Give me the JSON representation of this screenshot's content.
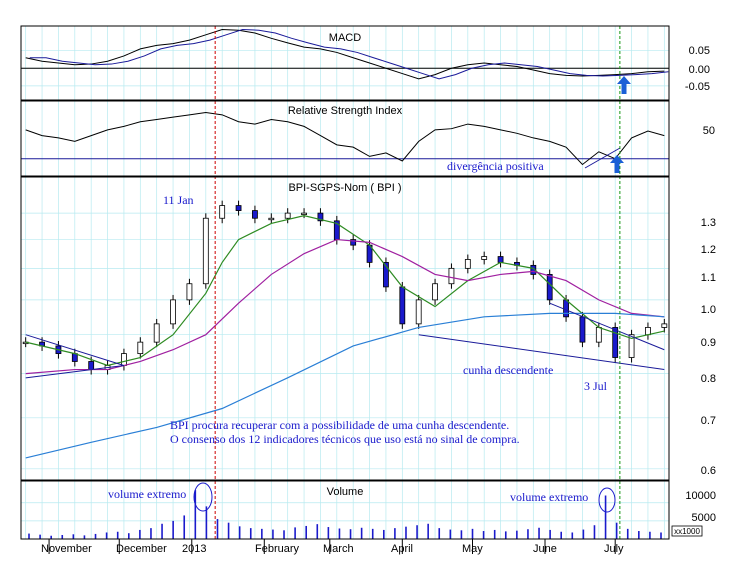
{
  "colors": {
    "grid": "#b7eaf0",
    "frame": "#000000",
    "annotation": "#1a1acc",
    "up_arrow": "#1a5fd6",
    "price_up": "#ffffff",
    "price_down": "#1a1acc",
    "ma_short": "#2e8b22",
    "ma_mid": "#a020a0",
    "ma_long": "#2a7fd6",
    "event_red": "#cc0000",
    "event_green": "#119911",
    "trend_line": "#1a1a99"
  },
  "chart_data": [
    {
      "type": "line",
      "title": "MACD",
      "y_ticks": [
        "0.05",
        "0.00",
        "-0.05"
      ],
      "ylim": [
        -0.09,
        0.12
      ],
      "series": [
        {
          "style": "macd",
          "points": [
            [
              "2012-10-22",
              0.03
            ],
            [
              "2012-10-29",
              0.02
            ],
            [
              "2012-11-05",
              0.015
            ],
            [
              "2012-11-12",
              0.01
            ],
            [
              "2012-11-19",
              0.012
            ],
            [
              "2012-11-26",
              0.02
            ],
            [
              "2012-12-03",
              0.035
            ],
            [
              "2012-12-10",
              0.055
            ],
            [
              "2012-12-17",
              0.065
            ],
            [
              "2012-12-24",
              0.07
            ],
            [
              "2012-12-31",
              0.08
            ],
            [
              "2013-01-07",
              0.095
            ],
            [
              "2013-01-14",
              0.11
            ],
            [
              "2013-01-21",
              0.108
            ],
            [
              "2013-01-28",
              0.1
            ],
            [
              "2013-02-04",
              0.085
            ],
            [
              "2013-02-11",
              0.072
            ],
            [
              "2013-02-18",
              0.06
            ],
            [
              "2013-02-25",
              0.055
            ],
            [
              "2013-03-04",
              0.045
            ],
            [
              "2013-03-11",
              0.03
            ],
            [
              "2013-03-18",
              0.015
            ],
            [
              "2013-03-25",
              0.0
            ],
            [
              "2013-04-01",
              -0.015
            ],
            [
              "2013-04-08",
              -0.03
            ],
            [
              "2013-04-15",
              -0.018
            ],
            [
              "2013-04-22",
              0.0
            ],
            [
              "2013-04-29",
              0.01
            ],
            [
              "2013-05-06",
              0.015
            ],
            [
              "2013-05-13",
              0.01
            ],
            [
              "2013-05-20",
              0.005
            ],
            [
              "2013-05-27",
              -0.005
            ],
            [
              "2013-06-03",
              -0.015
            ],
            [
              "2013-06-10",
              -0.02
            ],
            [
              "2013-06-17",
              -0.022
            ],
            [
              "2013-06-24",
              -0.02
            ],
            [
              "2013-07-01",
              -0.018
            ],
            [
              "2013-07-08",
              -0.015
            ],
            [
              "2013-07-15",
              -0.01
            ],
            [
              "2013-07-22",
              -0.008
            ]
          ]
        }
      ]
    },
    {
      "type": "line",
      "title": "Relative Strength Index",
      "y_ticks": [
        "50"
      ],
      "ylim": [
        15,
        80
      ],
      "series": [
        {
          "style": "rsi",
          "points": [
            [
              "2012-10-22",
              55
            ],
            [
              "2012-10-29",
              50
            ],
            [
              "2012-11-05",
              48
            ],
            [
              "2012-11-12",
              45
            ],
            [
              "2012-11-19",
              50
            ],
            [
              "2012-11-26",
              55
            ],
            [
              "2012-12-03",
              58
            ],
            [
              "2012-12-10",
              62
            ],
            [
              "2012-12-17",
              64
            ],
            [
              "2012-12-24",
              66
            ],
            [
              "2012-12-31",
              68
            ],
            [
              "2013-01-07",
              70
            ],
            [
              "2013-01-14",
              68
            ],
            [
              "2013-01-21",
              62
            ],
            [
              "2013-01-28",
              60
            ],
            [
              "2013-02-04",
              64
            ],
            [
              "2013-02-11",
              62
            ],
            [
              "2013-02-18",
              58
            ],
            [
              "2013-02-25",
              50
            ],
            [
              "2013-03-04",
              42
            ],
            [
              "2013-03-11",
              40
            ],
            [
              "2013-03-18",
              32
            ],
            [
              "2013-03-25",
              35
            ],
            [
              "2013-04-01",
              28
            ],
            [
              "2013-04-08",
              45
            ],
            [
              "2013-04-15",
              55
            ],
            [
              "2013-04-22",
              56
            ],
            [
              "2013-04-29",
              60
            ],
            [
              "2013-05-06",
              58
            ],
            [
              "2013-05-13",
              55
            ],
            [
              "2013-05-20",
              52
            ],
            [
              "2013-05-27",
              48
            ],
            [
              "2013-06-03",
              45
            ],
            [
              "2013-06-10",
              40
            ],
            [
              "2013-06-17",
              25
            ],
            [
              "2013-06-24",
              36
            ],
            [
              "2013-07-01",
              30
            ],
            [
              "2013-07-08",
              48
            ],
            [
              "2013-07-15",
              54
            ],
            [
              "2013-07-22",
              50
            ]
          ]
        }
      ],
      "reference_level": 30
    },
    {
      "type": "line",
      "title": "BPI-SGPS-Nom ( BPI )",
      "y_ticks": [
        "1.3",
        "1.2",
        "1.1",
        "1.0",
        "0.9",
        "0.8",
        "0.7",
        "0.6"
      ],
      "y_scale": "log",
      "ylim": [
        0.58,
        1.45
      ],
      "series": [
        {
          "style": "price",
          "points": [
            [
              "2012-10-22",
              0.88
            ],
            [
              "2012-10-29",
              0.87
            ],
            [
              "2012-11-05",
              0.85
            ],
            [
              "2012-11-12",
              0.83
            ],
            [
              "2012-11-19",
              0.81
            ],
            [
              "2012-11-26",
              0.82
            ],
            [
              "2012-12-03",
              0.85
            ],
            [
              "2012-12-10",
              0.88
            ],
            [
              "2012-12-17",
              0.93
            ],
            [
              "2012-12-24",
              1.0
            ],
            [
              "2012-12-31",
              1.05
            ],
            [
              "2013-01-07",
              1.28
            ],
            [
              "2013-01-14",
              1.33
            ],
            [
              "2013-01-21",
              1.31
            ],
            [
              "2013-01-28",
              1.28
            ],
            [
              "2013-02-04",
              1.28
            ],
            [
              "2013-02-11",
              1.3
            ],
            [
              "2013-02-18",
              1.3
            ],
            [
              "2013-02-25",
              1.27
            ],
            [
              "2013-03-04",
              1.2
            ],
            [
              "2013-03-11",
              1.18
            ],
            [
              "2013-03-18",
              1.12
            ],
            [
              "2013-03-25",
              1.04
            ],
            [
              "2013-04-01",
              0.93
            ],
            [
              "2013-04-08",
              1.0
            ],
            [
              "2013-04-15",
              1.05
            ],
            [
              "2013-04-22",
              1.1
            ],
            [
              "2013-04-29",
              1.13
            ],
            [
              "2013-05-06",
              1.14
            ],
            [
              "2013-05-13",
              1.12
            ],
            [
              "2013-05-20",
              1.11
            ],
            [
              "2013-05-27",
              1.08
            ],
            [
              "2013-06-03",
              1.0
            ],
            [
              "2013-06-10",
              0.95
            ],
            [
              "2013-06-17",
              0.88
            ],
            [
              "2013-06-24",
              0.92
            ],
            [
              "2013-07-01",
              0.84
            ],
            [
              "2013-07-08",
              0.9
            ],
            [
              "2013-07-15",
              0.92
            ],
            [
              "2013-07-22",
              0.93
            ]
          ]
        },
        {
          "style": "ma_short",
          "points": [
            [
              "2012-10-22",
              0.88
            ],
            [
              "2012-11-12",
              0.85
            ],
            [
              "2012-11-26",
              0.82
            ],
            [
              "2012-12-10",
              0.84
            ],
            [
              "2012-12-24",
              0.9
            ],
            [
              "2013-01-07",
              1.02
            ],
            [
              "2013-01-14",
              1.12
            ],
            [
              "2013-01-21",
              1.2
            ],
            [
              "2013-02-04",
              1.26
            ],
            [
              "2013-02-18",
              1.29
            ],
            [
              "2013-03-04",
              1.26
            ],
            [
              "2013-03-18",
              1.18
            ],
            [
              "2013-04-01",
              1.04
            ],
            [
              "2013-04-15",
              0.98
            ],
            [
              "2013-04-29",
              1.06
            ],
            [
              "2013-05-13",
              1.12
            ],
            [
              "2013-05-27",
              1.1
            ],
            [
              "2013-06-10",
              1.0
            ],
            [
              "2013-06-24",
              0.92
            ],
            [
              "2013-07-08",
              0.89
            ],
            [
              "2013-07-22",
              0.91
            ]
          ]
        },
        {
          "style": "ma_mid",
          "points": [
            [
              "2012-10-22",
              0.8
            ],
            [
              "2012-11-12",
              0.81
            ],
            [
              "2012-11-26",
              0.81
            ],
            [
              "2012-12-10",
              0.83
            ],
            [
              "2012-12-24",
              0.86
            ],
            [
              "2013-01-07",
              0.9
            ],
            [
              "2013-01-21",
              0.99
            ],
            [
              "2013-02-04",
              1.08
            ],
            [
              "2013-02-18",
              1.15
            ],
            [
              "2013-03-04",
              1.2
            ],
            [
              "2013-03-18",
              1.19
            ],
            [
              "2013-04-01",
              1.14
            ],
            [
              "2013-04-15",
              1.08
            ],
            [
              "2013-04-29",
              1.06
            ],
            [
              "2013-05-13",
              1.08
            ],
            [
              "2013-05-27",
              1.09
            ],
            [
              "2013-06-10",
              1.06
            ],
            [
              "2013-06-24",
              1.0
            ],
            [
              "2013-07-08",
              0.96
            ],
            [
              "2013-07-22",
              0.95
            ]
          ]
        },
        {
          "style": "ma_long",
          "points": [
            [
              "2012-10-22",
              0.62
            ],
            [
              "2012-11-19",
              0.65
            ],
            [
              "2012-12-17",
              0.68
            ],
            [
              "2013-01-14",
              0.72
            ],
            [
              "2013-02-11",
              0.79
            ],
            [
              "2013-03-11",
              0.87
            ],
            [
              "2013-04-08",
              0.92
            ],
            [
              "2013-05-06",
              0.95
            ],
            [
              "2013-06-03",
              0.96
            ],
            [
              "2013-07-01",
              0.96
            ],
            [
              "2013-07-22",
              0.95
            ]
          ]
        }
      ],
      "trend_lines": [
        {
          "style": "trend",
          "points": [
            [
              "2012-10-22",
              0.9
            ],
            [
              "2012-12-03",
              0.82
            ]
          ]
        },
        {
          "style": "trend",
          "points": [
            [
              "2012-10-22",
              0.79
            ],
            [
              "2012-12-03",
              0.82
            ]
          ]
        },
        {
          "style": "trend",
          "points": [
            [
              "2013-04-08",
              0.9
            ],
            [
              "2013-07-22",
              0.81
            ]
          ]
        },
        {
          "style": "trend",
          "points": [
            [
              "2013-06-03",
              0.99
            ],
            [
              "2013-07-22",
              0.86
            ]
          ]
        }
      ],
      "annotations": {
        "jan_label": "11  Jan",
        "wedge_label": "cunha descendente",
        "jul_label": "3 Jul",
        "comment_line1": "BPI procura recuperar com a possibilidade de uma cunha descendente.",
        "comment_line2": "O consenso dos 12 indicadores técnicos que uso está no sinal de compra."
      }
    },
    {
      "type": "bar",
      "title": "Volume",
      "y_ticks": [
        "10000",
        "5000"
      ],
      "unit": "x1000",
      "ylim": [
        0,
        16000
      ],
      "values": [
        1500,
        1200,
        900,
        1100,
        1300,
        1000,
        1400,
        1800,
        2000,
        1600,
        2500,
        3000,
        4200,
        5000,
        6500,
        13500,
        9000,
        5500,
        4500,
        3500,
        3000,
        2800,
        2600,
        2400,
        3200,
        3600,
        4100,
        3300,
        2900,
        2700,
        3100,
        2800,
        2500,
        3000,
        3400,
        3800,
        4200,
        3000,
        2600,
        2400,
        2800,
        2200,
        2500,
        2100,
        2300,
        2700,
        3100,
        2500,
        2000,
        1800,
        2600,
        3800,
        12000,
        4500,
        2800,
        2200,
        2000,
        1800
      ]
    }
  ],
  "months": [
    "November",
    "December",
    "2013",
    "February",
    "March",
    "April",
    "May",
    "June",
    "July"
  ],
  "month_dates": [
    "2012-11-01",
    "2012-12-01",
    "2013-01-01",
    "2013-02-01",
    "2013-03-01",
    "2013-04-01",
    "2013-05-01",
    "2013-06-01",
    "2013-07-01"
  ],
  "events": [
    {
      "date": "2013-01-11",
      "color_key": "event_red"
    },
    {
      "date": "2013-07-03",
      "color_key": "event_green"
    }
  ],
  "date_range": [
    "2012-10-20",
    "2013-07-24"
  ],
  "text": {
    "rsi_note": "divergência positiva",
    "volume_left_note": "volume extremo",
    "volume_right_note": "volume extremo"
  }
}
